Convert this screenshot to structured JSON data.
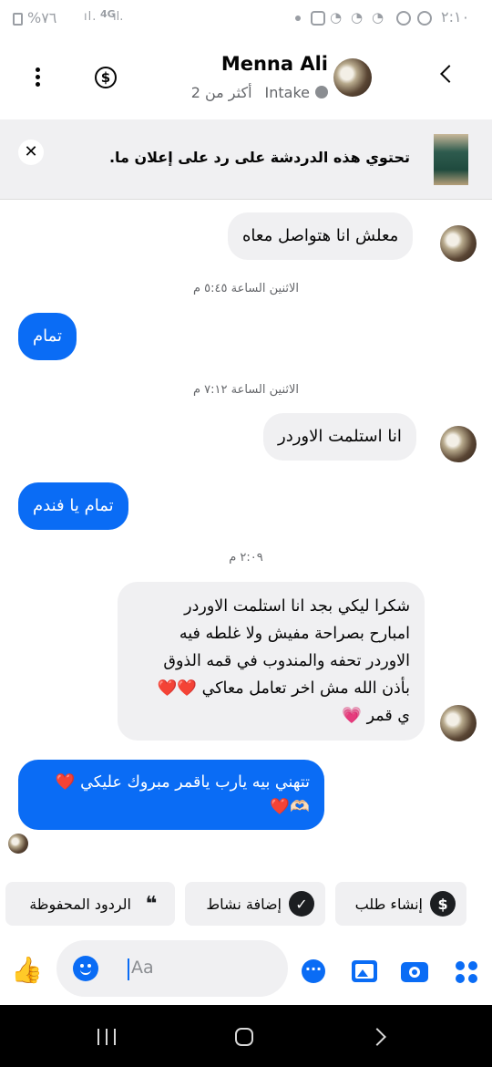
{
  "status_bar": {
    "time": "٢:١٠",
    "battery": "%٧٦",
    "network": "4G"
  },
  "header": {
    "contact_name": "Menna Ali",
    "status_label": "Intake",
    "age_label": "أكثر من 2"
  },
  "ad_banner": {
    "text": "تحتوي هذه الدردشة على رد على إعلان ما."
  },
  "messages": [
    {
      "type": "in",
      "text": "معلش انا هتواصل معاه"
    },
    {
      "type": "time",
      "text": "الاثنين الساعة ٥:٤٥ م"
    },
    {
      "type": "out",
      "text": "تمام"
    },
    {
      "type": "time",
      "text": "الاثنين الساعة ٧:١٢ م"
    },
    {
      "type": "in",
      "text": "انا استلمت الاوردر"
    },
    {
      "type": "out",
      "text": "تمام يا فندم"
    },
    {
      "type": "time",
      "text": "٢:٠٩ م"
    },
    {
      "type": "in",
      "lines": [
        "شكرا ليكي بجد انا استلمت الاوردر",
        "امبارح بصراحة مفيش ولا غلطه فيه",
        "الاوردر تحفه والمندوب في قمه الذوق",
        "بأذن الله مش اخر تعامل معاكي ❤️❤️",
        "ي قمر 💗"
      ]
    },
    {
      "type": "out",
      "lines": [
        "تتهني بيه يارب ياقمر مبروك عليكي ❤️",
        "🫶🏻❤️"
      ]
    }
  ],
  "quick_actions": [
    {
      "label": "إنشاء طلب",
      "icon": "dollar-icon"
    },
    {
      "label": "إضافة نشاط",
      "icon": "check-icon"
    },
    {
      "label": "الردود المحفوظة",
      "icon": "chat-bubbles-icon"
    }
  ],
  "composer": {
    "placeholder": "Aa"
  },
  "colors": {
    "accent": "#0a6cf5",
    "incoming_bubble": "#f0f0f2",
    "banner_bg": "#f0f0f2"
  }
}
